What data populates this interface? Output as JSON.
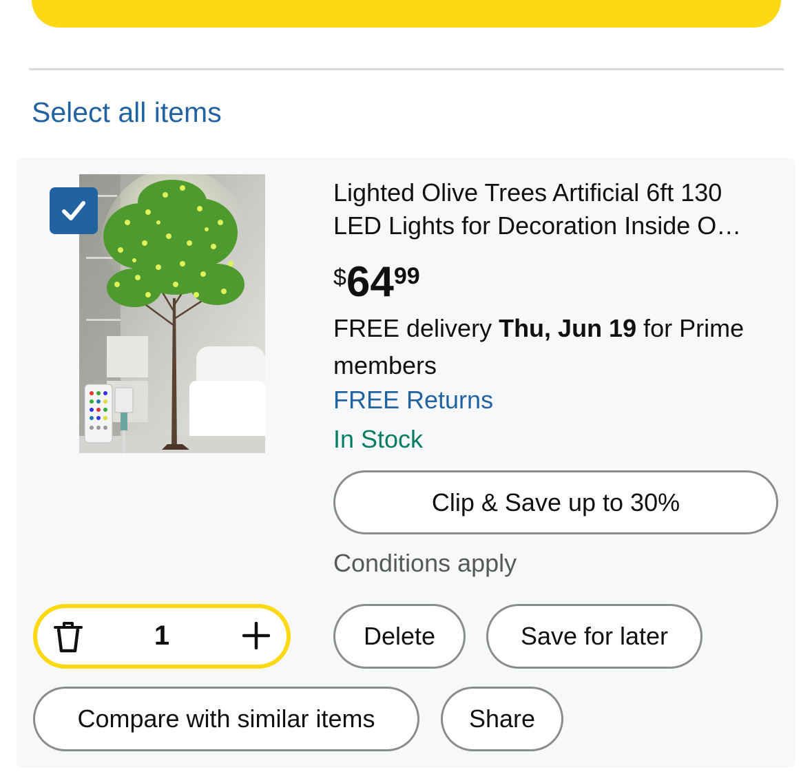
{
  "header": {
    "select_all": "Select all items"
  },
  "cart_item": {
    "checked": true,
    "title_line1": "Lighted Olive Trees Artificial 6ft 130",
    "title_line2": "LED Lights for Decoration Inside O…",
    "price": {
      "symbol": "$",
      "whole": "64",
      "fraction": "99"
    },
    "delivery": {
      "prefix": "FREE delivery ",
      "date": "Thu, Jun 19",
      "suffix": " for Prime members"
    },
    "returns": "FREE Returns",
    "stock": "In Stock",
    "coupon_button": "Clip & Save up to 30%",
    "conditions": "Conditions apply",
    "quantity": "1",
    "actions": {
      "delete": "Delete",
      "save_for_later": "Save for later",
      "compare": "Compare with similar items",
      "share": "Share"
    }
  },
  "colors": {
    "accent_yellow": "#ffd814",
    "link_blue": "#2162a1",
    "stock_green": "#067d62",
    "card_bg": "#f7f8fa"
  },
  "icons": {
    "checkbox": "check-icon",
    "quantity_delete": "trash-icon",
    "quantity_increase": "plus-icon"
  }
}
